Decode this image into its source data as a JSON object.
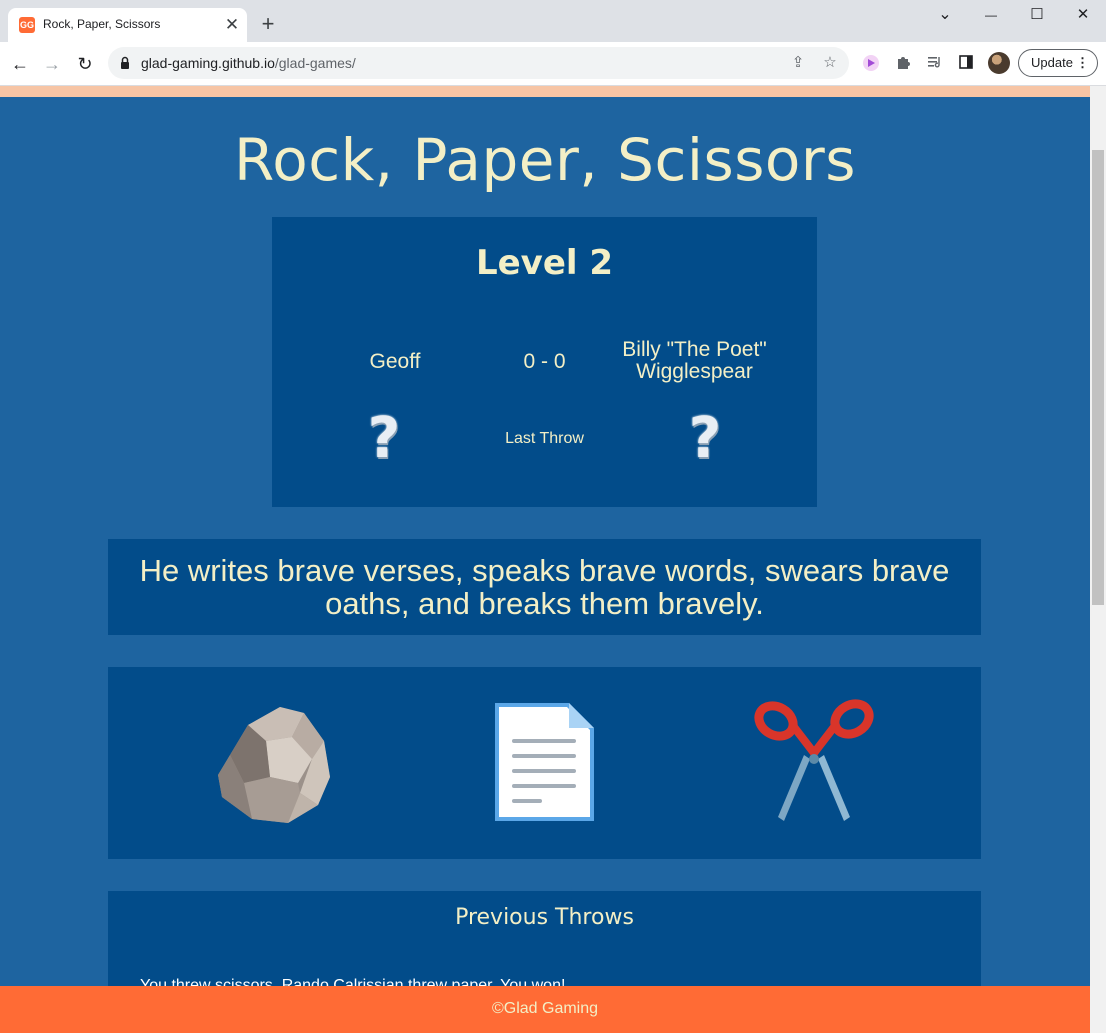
{
  "browser": {
    "tab_title": "Rock, Paper, Scissors",
    "favicon_text": "GG",
    "tab_close": "✕",
    "new_tab": "+",
    "url_host": "glad-gaming.github.io",
    "url_path": "/glad-games/",
    "update_label": "Update",
    "menu_dots": "⋮",
    "window_controls": {
      "dropdown": "⌄",
      "minimize": "—",
      "maximize": "☐",
      "close": "✕"
    },
    "nav": {
      "back": "←",
      "forward": "→",
      "reload": "↻"
    }
  },
  "game": {
    "title": "Rock, Paper, Scissors",
    "level": "Level 2",
    "player_name": "Geoff",
    "score": "0 - 0",
    "opponent_name": "Billy \"The Poet\" Wigglespear",
    "player_throw": "?",
    "opponent_throw": "?",
    "last_throw_label": "Last Throw",
    "quote": "He writes brave verses, speaks brave words, swears brave oaths, and breaks them bravely.",
    "choices": [
      {
        "name": "rock",
        "icon": "rock-icon"
      },
      {
        "name": "paper",
        "icon": "paper-icon"
      },
      {
        "name": "scissors",
        "icon": "scissors-icon"
      }
    ],
    "history_title": "Previous Throws",
    "history": [
      "You threw scissors. Rando Calrissian threw paper. You won!"
    ]
  },
  "footer": {
    "text": "©Glad Gaming"
  },
  "colors": {
    "page_bg": "#1e64a0",
    "panel_bg": "#024c8a",
    "text_cream": "#f3efc6",
    "footer_bg": "#ff6b35",
    "top_strip": "#f7c5a5"
  }
}
